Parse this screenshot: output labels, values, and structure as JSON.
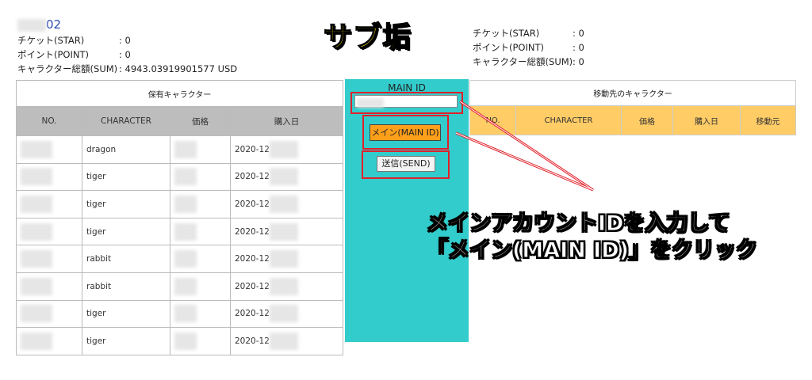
{
  "account": {
    "title_suffix": "02",
    "rows": [
      {
        "label": "チケット(STAR)",
        "value": ": 0"
      },
      {
        "label": "ポイント(POINT)",
        "value": ": 0"
      },
      {
        "label": "キャラクター総額(SUM)",
        "value": ": 4943.03919901577 USD"
      }
    ]
  },
  "overlay_title": "サブ垢",
  "sub_account": {
    "rows": [
      {
        "label": "チケット(STAR)",
        "value": ": 0"
      },
      {
        "label": "ポイント(POINT)",
        "value": ": 0"
      },
      {
        "label": "キャラクター総額(SUM)",
        "value": ": 0"
      }
    ]
  },
  "owned_table": {
    "caption": "保有キャラクター",
    "headers": [
      "NO.",
      "CHARACTER",
      "価格",
      "購入日"
    ],
    "rows": [
      {
        "character": "dragon",
        "date": "2020-12"
      },
      {
        "character": "tiger",
        "date": "2020-12"
      },
      {
        "character": "tiger",
        "date": "2020-12"
      },
      {
        "character": "tiger",
        "date": "2020-12"
      },
      {
        "character": "rabbit",
        "date": "2020-12"
      },
      {
        "character": "rabbit",
        "date": "2020-12"
      },
      {
        "character": "tiger",
        "date": "2020-12"
      },
      {
        "character": "tiger",
        "date": "2020-12"
      }
    ]
  },
  "mid_panel": {
    "label": "MAIN ID",
    "main_button": "メイン(MAIN ID)",
    "send_button": "送信(SEND)"
  },
  "dest_table": {
    "caption": "移動先のキャラクター",
    "headers": [
      "NO.",
      "CHARACTER",
      "価格",
      "購入日",
      "移動元"
    ]
  },
  "annotation": {
    "line1": "メインアカウントIDを入力して",
    "line2": "「メイン(MAIN ID)」をクリック"
  },
  "colors": {
    "panel": "#33cccc",
    "main_button": "#ff9f1a",
    "dest_header": "#ffcc66",
    "owned_header": "#bdbdbd",
    "highlight": "#e0202a"
  }
}
